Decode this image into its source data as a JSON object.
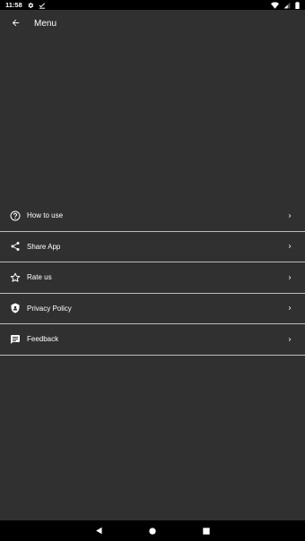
{
  "status_bar": {
    "time": "11:58",
    "icons": [
      "gear-icon",
      "download-check-icon",
      "wifi-icon",
      "signal-icon",
      "battery-icon"
    ]
  },
  "app_bar": {
    "title": "Menu",
    "back_icon": "arrow-back-icon"
  },
  "menu": {
    "items": [
      {
        "label": "How to use",
        "icon": "help-circle-icon"
      },
      {
        "label": "Share App",
        "icon": "share-icon"
      },
      {
        "label": "Rate us",
        "icon": "star-outline-icon"
      },
      {
        "label": "Privacy Policy",
        "icon": "shield-lock-icon"
      },
      {
        "label": "Feedback",
        "icon": "feedback-icon"
      }
    ],
    "chevron_icon": "chevron-right-icon"
  },
  "nav_bar": {
    "buttons": [
      "nav-back-icon",
      "nav-home-icon",
      "nav-recents-icon"
    ]
  },
  "colors": {
    "background": "#303030",
    "status_bar": "#000000",
    "nav_bar": "#000000",
    "divider": "#bdbdbd",
    "text": "#ffffff"
  }
}
